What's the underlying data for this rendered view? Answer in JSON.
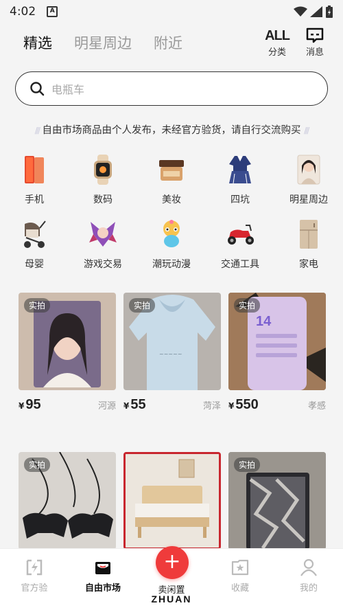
{
  "status": {
    "time": "4:02",
    "notif_letter": "A"
  },
  "top_nav": {
    "tabs": [
      "精选",
      "明星周边",
      "附近"
    ],
    "actions": [
      {
        "big": "ALL",
        "label": "分类"
      },
      {
        "label": "消息"
      }
    ]
  },
  "search": {
    "placeholder": "电瓶车"
  },
  "notice": "自由市场商品由个人发布，未经官方验货，请自行交流购买",
  "categories": [
    {
      "label": "手机",
      "icon": "phone-icon"
    },
    {
      "label": "数码",
      "icon": "watch-icon"
    },
    {
      "label": "美妆",
      "icon": "cosmetics-icon"
    },
    {
      "label": "四坑",
      "icon": "uniform-icon"
    },
    {
      "label": "明星周边",
      "icon": "star-photo-icon"
    },
    {
      "label": "母婴",
      "icon": "stroller-icon"
    },
    {
      "label": "游戏交易",
      "icon": "game-character-icon"
    },
    {
      "label": "潮玩动漫",
      "icon": "toy-figure-icon"
    },
    {
      "label": "交通工具",
      "icon": "scooter-icon"
    },
    {
      "label": "家电",
      "icon": "fridge-icon"
    }
  ],
  "products": [
    {
      "tag": "实拍",
      "yen": "¥",
      "price": "95",
      "location": "河源",
      "img_color": "#c9b7a8"
    },
    {
      "tag": "实拍",
      "yen": "¥",
      "price": "55",
      "location": "菏泽",
      "img_color": "#c7d6e2"
    },
    {
      "tag": "实拍",
      "yen": "¥",
      "price": "550",
      "location": "孝感",
      "img_color": "#a98a6e"
    },
    {
      "tag": "实拍",
      "yen": "",
      "price": "",
      "location": "",
      "img_color": "#d8d4cf"
    },
    {
      "tag": "",
      "yen": "",
      "price": "",
      "location": "",
      "img_color": "#e9e3db"
    },
    {
      "tag": "实拍",
      "yen": "",
      "price": "",
      "location": "",
      "img_color": "#8f8a84"
    }
  ],
  "bottom_nav": {
    "items": [
      "官方验",
      "自由市场",
      "",
      "收藏",
      "我的"
    ],
    "sell_label": "卖闲置",
    "brand": "ZHUAN"
  },
  "colors": {
    "accent": "#ef3b3b",
    "text": "#222222",
    "muted": "#aaaaaa"
  }
}
